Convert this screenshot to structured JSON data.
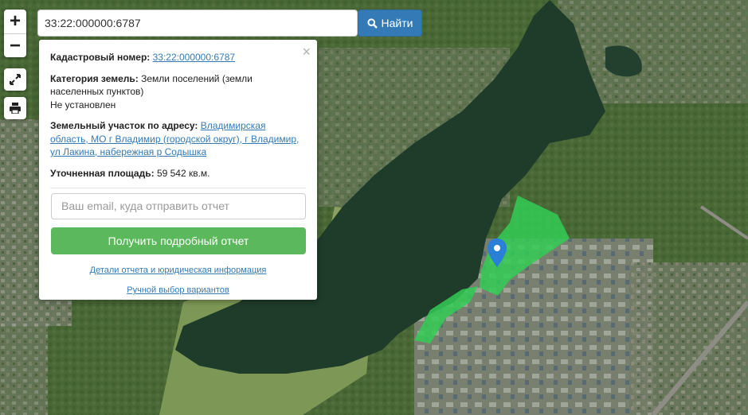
{
  "map": {
    "zoom_in": "+",
    "zoom_out": "−",
    "parcel_color": "#33cc55",
    "water_color": "#1f3b2a"
  },
  "search": {
    "value": "33:22:000000:6787",
    "button_label": "Найти"
  },
  "popup": {
    "cadastral_label": "Кадастровый номер:",
    "cadastral_value": "33:22:000000:6787",
    "category_label": "Категория земель:",
    "category_value_1": "Земли поселений (земли",
    "category_value_2": "населенных пунктов)",
    "category_value_3": "Не установлен",
    "address_label": "Земельный участок по адресу:",
    "address_value_1": "Владимирская",
    "address_value_2": "область, МО г Владимир (городской округ), г Владимир,",
    "address_value_3": "ул Лакина, набережная р Содышка",
    "area_label": "Уточненная площадь:",
    "area_value": "59 542 кв.м.",
    "email_placeholder": "Ваш email, куда отправить отчет",
    "report_button": "Получить подробный отчет",
    "details_link": "Детали отчета и юридическая информация",
    "manual_link": "Ручной выбор вариантов",
    "close": "×"
  }
}
